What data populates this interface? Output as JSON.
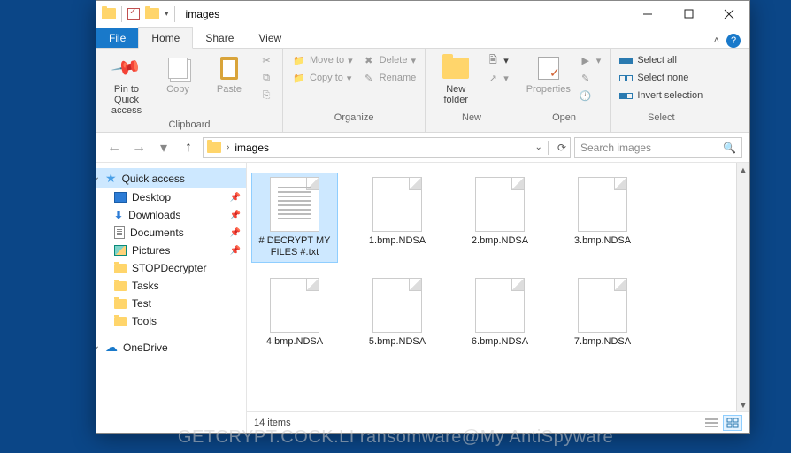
{
  "window": {
    "title": "images"
  },
  "tabs": {
    "file": "File",
    "home": "Home",
    "share": "Share",
    "view": "View"
  },
  "ribbon": {
    "clipboard": {
      "label": "Clipboard",
      "pin": "Pin to Quick access",
      "copy": "Copy",
      "paste": "Paste"
    },
    "organize": {
      "label": "Organize",
      "moveto": "Move to",
      "copyto": "Copy to",
      "delete": "Delete",
      "rename": "Rename"
    },
    "new": {
      "label": "New",
      "newfolder": "New folder"
    },
    "open": {
      "label": "Open",
      "properties": "Properties"
    },
    "select": {
      "label": "Select",
      "selectall": "Select all",
      "selectnone": "Select none",
      "invert": "Invert selection"
    }
  },
  "address": {
    "location": "images",
    "search_placeholder": "Search images"
  },
  "sidebar": {
    "quickaccess": "Quick access",
    "desktop": "Desktop",
    "downloads": "Downloads",
    "documents": "Documents",
    "pictures": "Pictures",
    "stopdecrypter": "STOPDecrypter",
    "tasks": "Tasks",
    "test": "Test",
    "tools": "Tools",
    "onedrive": "OneDrive"
  },
  "files": [
    {
      "name": "# DECRYPT MY FILES #.txt",
      "type": "txt",
      "selected": true
    },
    {
      "name": "1.bmp.NDSA",
      "type": "blank"
    },
    {
      "name": "2.bmp.NDSA",
      "type": "blank"
    },
    {
      "name": "3.bmp.NDSA",
      "type": "blank"
    },
    {
      "name": "4.bmp.NDSA",
      "type": "blank"
    },
    {
      "name": "5.bmp.NDSA",
      "type": "blank"
    },
    {
      "name": "6.bmp.NDSA",
      "type": "blank"
    },
    {
      "name": "7.bmp.NDSA",
      "type": "blank"
    }
  ],
  "status": {
    "count": "14 items"
  },
  "watermark": "GETCRYPT.COCK.LI ransomware@My AntiSpyware"
}
